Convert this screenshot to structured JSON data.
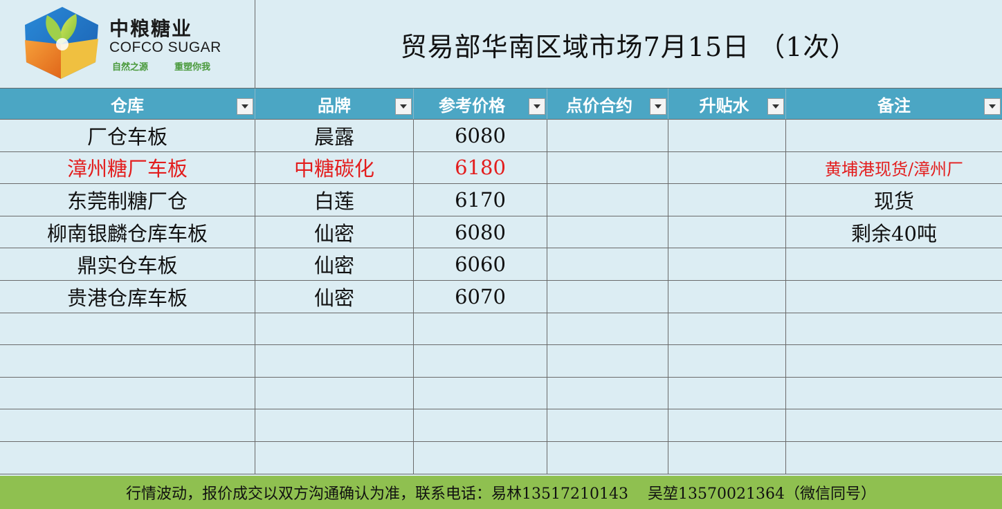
{
  "logo": {
    "cn": "中粮糖业",
    "en": "COFCO SUGAR",
    "slogan_left": "自然之源",
    "slogan_right": "重塑你我"
  },
  "title": "贸易部华南区域市场7月15日  （1次）",
  "columns": [
    "仓库",
    "品牌",
    "参考价格",
    "点价合约",
    "升贴水",
    "备注"
  ],
  "rows": [
    {
      "warehouse": "厂仓车板",
      "brand": "晨露",
      "price": "6080",
      "contract": "",
      "premium": "",
      "note": "",
      "highlight": false
    },
    {
      "warehouse": "漳州糖厂车板",
      "brand": "中糖碳化",
      "price": "6180",
      "contract": "",
      "premium": "",
      "note": "黄埔港现货/漳州厂",
      "highlight": true
    },
    {
      "warehouse": "东莞制糖厂仓",
      "brand": "白莲",
      "price": "6170",
      "contract": "",
      "premium": "",
      "note": "现货",
      "highlight": false
    },
    {
      "warehouse": "柳南银麟仓库车板",
      "brand": "仙密",
      "price": "6080",
      "contract": "",
      "premium": "",
      "note": "剩余40吨",
      "highlight": false
    },
    {
      "warehouse": "鼎实仓车板",
      "brand": "仙密",
      "price": "6060",
      "contract": "",
      "premium": "",
      "note": "",
      "highlight": false
    },
    {
      "warehouse": "贵港仓库车板",
      "brand": "仙密",
      "price": "6070",
      "contract": "",
      "premium": "",
      "note": "",
      "highlight": false
    },
    {
      "warehouse": "",
      "brand": "",
      "price": "",
      "contract": "",
      "premium": "",
      "note": "",
      "highlight": false
    },
    {
      "warehouse": "",
      "brand": "",
      "price": "",
      "contract": "",
      "premium": "",
      "note": "",
      "highlight": false
    },
    {
      "warehouse": "",
      "brand": "",
      "price": "",
      "contract": "",
      "premium": "",
      "note": "",
      "highlight": false
    },
    {
      "warehouse": "",
      "brand": "",
      "price": "",
      "contract": "",
      "premium": "",
      "note": "",
      "highlight": false
    },
    {
      "warehouse": "",
      "brand": "",
      "price": "",
      "contract": "",
      "premium": "",
      "note": "",
      "highlight": false
    }
  ],
  "footer": "行情波动，报价成交以双方沟通确认为准，联系电话：易林13517210143    吴堃13570021364（微信同号）",
  "colors": {
    "header_bg": "#4ba6c4",
    "sheet_bg": "#dcedf3",
    "footer_bg": "#8fc050",
    "highlight_text": "#e31d1d"
  },
  "icons": [
    "cofco-logo-icon",
    "filter-dropdown-icon"
  ]
}
